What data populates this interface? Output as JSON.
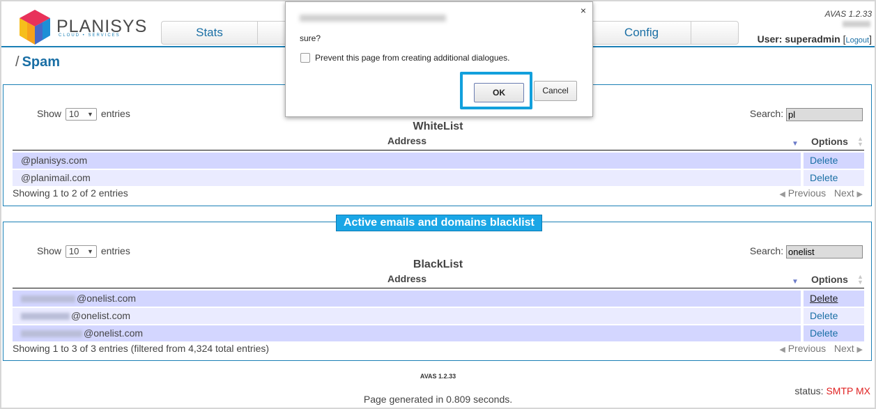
{
  "header": {
    "logo_name": "PLANISYS",
    "logo_sub": "CLOUD • SERVICES",
    "nav": {
      "stats": "Stats",
      "config": "Config"
    },
    "version": "AVAS 1.2.33",
    "user_label": "User: superadmin",
    "logout": "Logout"
  },
  "breadcrumb": {
    "sep": "/",
    "title": "Spam"
  },
  "whitelist": {
    "show_label": "Show",
    "show_value": "10",
    "entries_label": "entries",
    "search_label": "Search:",
    "search_value": "pl",
    "caption": "WhiteList",
    "col_address": "Address",
    "col_options": "Options",
    "rows": [
      {
        "address": "@planisys.com",
        "option": "Delete"
      },
      {
        "address": "@planimail.com",
        "option": "Delete"
      }
    ],
    "info": "Showing 1 to 2 of 2 entries",
    "previous": "Previous",
    "next": "Next"
  },
  "blacklist": {
    "legend": "Active emails and domains blacklist",
    "show_label": "Show",
    "show_value": "10",
    "entries_label": "entries",
    "search_label": "Search:",
    "search_value": "onelist",
    "caption": "BlackList",
    "col_address": "Address",
    "col_options": "Options",
    "rows": [
      {
        "address": "@onelist.com",
        "option": "Delete"
      },
      {
        "address": "@onelist.com",
        "option": "Delete"
      },
      {
        "address": "@onelist.com",
        "option": "Delete"
      }
    ],
    "info": "Showing 1 to 3 of 3 entries (filtered from 4,324 total entries)",
    "previous": "Previous",
    "next": "Next"
  },
  "footer": {
    "version": "AVAS 1.2.33",
    "status_label": "status:",
    "status_value": "SMTP MX",
    "generated": "Page generated in 0.809 seconds."
  },
  "dialog": {
    "close": "×",
    "message": "sure?",
    "checkbox_label": "Prevent this page from creating additional dialogues.",
    "ok": "OK",
    "cancel": "Cancel"
  },
  "colors": {
    "accent": "#1a7fb5",
    "legend": "#1aa6e6",
    "row_odd": "#d3d6ff",
    "row_even": "#eaebff",
    "status": "#e02020"
  }
}
